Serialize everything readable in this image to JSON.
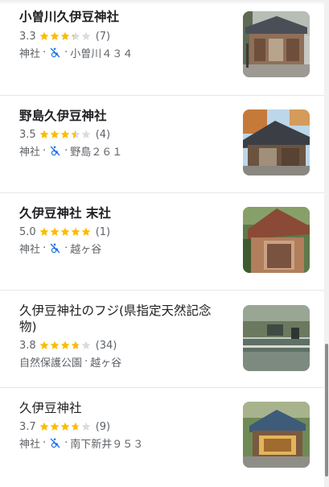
{
  "results": [
    {
      "name": "小曽川久伊豆神社",
      "rating": "3.3",
      "rating_value": 3.3,
      "reviews": "(7)",
      "category": "神社",
      "sep": "·",
      "address": "小曽川４３４",
      "wheelchair": true,
      "bold": true,
      "wheelchair_icon": "no-wheelchair-icon"
    },
    {
      "name": "野島久伊豆神社",
      "rating": "3.5",
      "rating_value": 3.5,
      "reviews": "(4)",
      "category": "神社",
      "sep": "·",
      "address": "野島２６１",
      "wheelchair": true,
      "bold": true,
      "wheelchair_icon": "no-wheelchair-icon"
    },
    {
      "name": "久伊豆神社 末社",
      "rating": "5.0",
      "rating_value": 5.0,
      "reviews": "(1)",
      "category": "神社",
      "sep": "·",
      "address": "越ヶ谷",
      "wheelchair": true,
      "bold": true,
      "wheelchair_icon": "no-wheelchair-icon"
    },
    {
      "name": "久伊豆神社のフジ(県指定天然記念物)",
      "rating": "3.8",
      "rating_value": 3.8,
      "reviews": "(34)",
      "category": "自然保護公園",
      "sep": "·",
      "address": "越ヶ谷",
      "wheelchair": false,
      "bold": false
    },
    {
      "name": "久伊豆神社",
      "rating": "3.7",
      "rating_value": 3.7,
      "reviews": "(9)",
      "category": "神社",
      "sep": "·",
      "address": "南下新井９５３",
      "wheelchair": true,
      "bold": false,
      "wheelchair_icon": "no-wheelchair-icon"
    }
  ],
  "colors": {
    "star_filled": "#fbbc04",
    "star_empty": "#dadce0",
    "wheelchair_icon": "#1a73e8"
  }
}
